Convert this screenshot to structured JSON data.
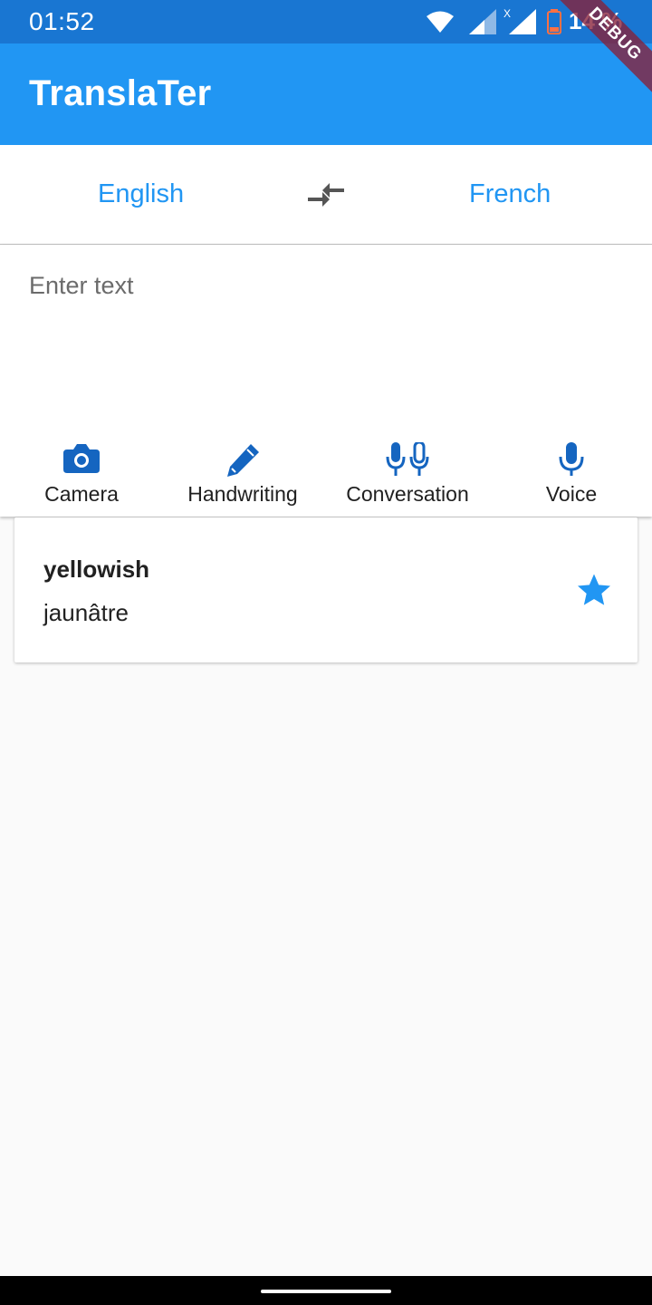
{
  "status_bar": {
    "time": "01:52",
    "battery": "14 %",
    "icons": [
      "wifi-icon",
      "signal-icon",
      "signal-no-data-icon",
      "battery-low-icon"
    ]
  },
  "app_bar": {
    "title": "TranslaTer",
    "debug_banner": "DEBUG"
  },
  "language_bar": {
    "source": "English",
    "target": "French",
    "swap_icon": "swap-arrows-icon"
  },
  "input": {
    "placeholder": "Enter text",
    "value": ""
  },
  "actions": [
    {
      "label": "Camera",
      "icon": "camera-icon"
    },
    {
      "label": "Handwriting",
      "icon": "pencil-icon"
    },
    {
      "label": "Conversation",
      "icon": "dual-mic-icon"
    },
    {
      "label": "Voice",
      "icon": "mic-icon"
    }
  ],
  "history": [
    {
      "source": "yellowish",
      "translation": "jaunâtre",
      "starred": true,
      "icon": "star-icon"
    }
  ],
  "colors": {
    "status_bar": "#1976d2",
    "app_bar": "#2196f3",
    "accent": "#2196f3",
    "icon_dark_blue": "#1565c0",
    "background": "#fafafa"
  }
}
